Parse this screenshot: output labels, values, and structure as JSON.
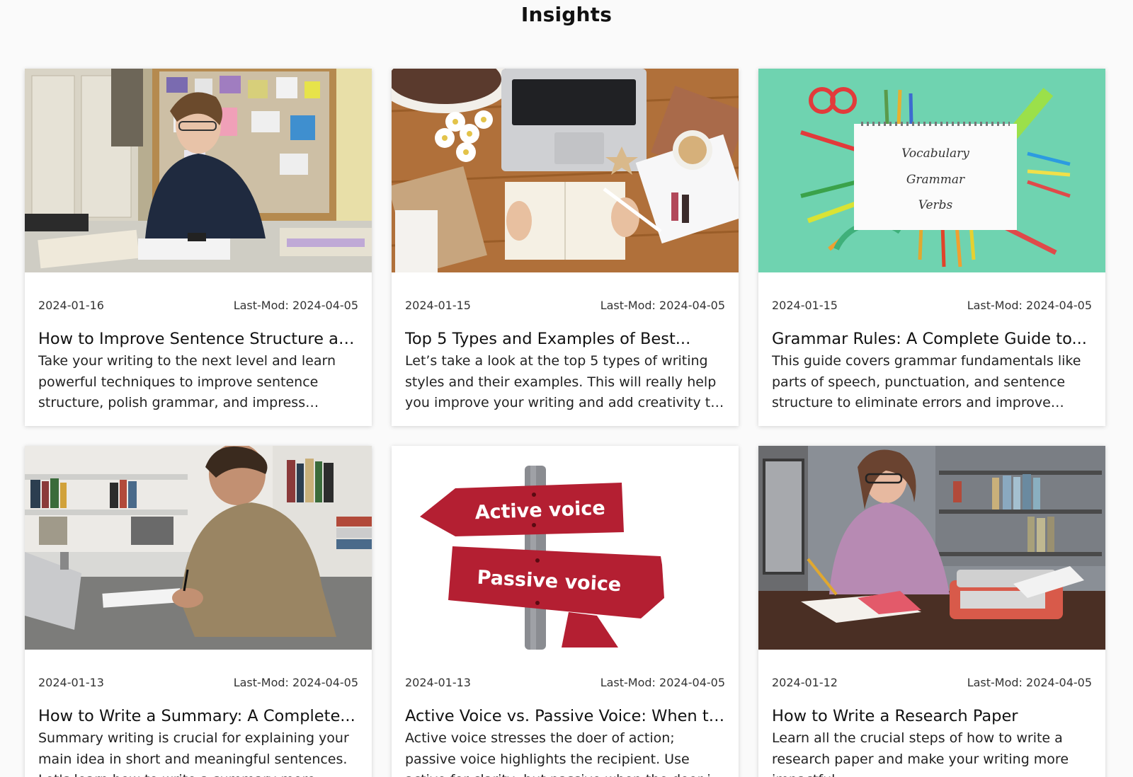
{
  "page": {
    "title": "Insights"
  },
  "cards": [
    {
      "date": "2024-01-16",
      "last_mod": "Last-Mod: 2024-04-05",
      "title": "How to Improve Sentence Structure and...",
      "excerpt": "Take your writing to the next level and learn powerful techniques to improve sentence structure, polish grammar, and impress readers.",
      "image": "student-studying-photo"
    },
    {
      "date": "2024-01-15",
      "last_mod": "Last-Mod: 2024-04-05",
      "title": "Top 5 Types and Examples of Best...",
      "excerpt": "Let’s take a look at the top 5 types of writing styles and their examples. This will really help you improve your writing and add creativity to it.",
      "image": "desk-laptop-notebook-photo"
    },
    {
      "date": "2024-01-15",
      "last_mod": "Last-Mod: 2024-04-05",
      "title": "Grammar Rules: A Complete Guide to...",
      "excerpt": "This guide covers grammar fundamentals like parts of speech, punctuation, and sentence structure to eliminate errors and improve writin...",
      "image": "grammar-notepad-photo",
      "image_text": [
        "Vocabulary",
        "Grammar",
        "Verbs"
      ]
    },
    {
      "date": "2024-01-13",
      "last_mod": "Last-Mod: 2024-04-05",
      "title": "How to Write a Summary: A Complete...",
      "excerpt": "Summary writing is crucial for explaining your main idea in short and meaningful sentences. Let's learn how to write a summary more easily.",
      "image": "man-writing-photo"
    },
    {
      "date": "2024-01-13",
      "last_mod": "Last-Mod: 2024-04-05",
      "title": "Active Voice vs. Passive Voice: When to...",
      "excerpt": "Active voice stresses the doer of action; passive voice highlights the recipient. Use active for clarity, but passive when the doer is unknown or...",
      "image": "voice-signpost-photo",
      "image_text": [
        "Active voice",
        "Passive voice"
      ]
    },
    {
      "date": "2024-01-12",
      "last_mod": "Last-Mod: 2024-04-05",
      "title": "How to Write a Research Paper",
      "excerpt": "Learn all the crucial steps of how to write a research paper and make your writing more impactful.",
      "image": "woman-typewriter-photo"
    }
  ],
  "colors": {
    "background": "#fafafa",
    "card": "#ffffff",
    "sign_red": "#b41f32",
    "mint": "#6fd3b0"
  }
}
